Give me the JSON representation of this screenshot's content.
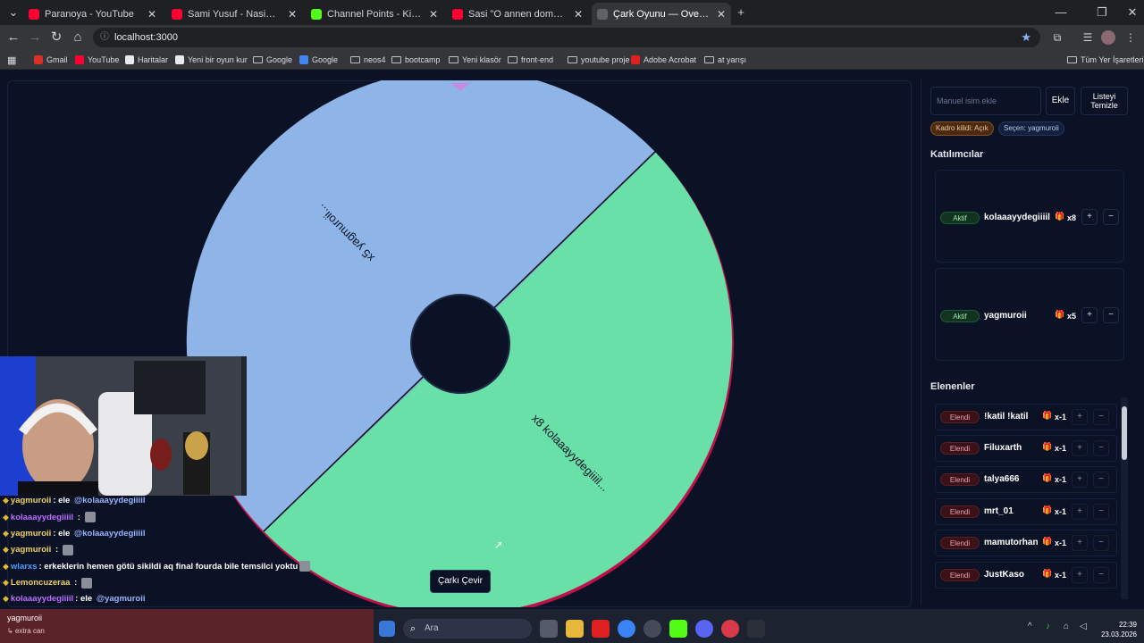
{
  "browser": {
    "tabs": [
      {
        "title": "Paranoya - YouTube",
        "color": "#ff0033",
        "active": false
      },
      {
        "title": "Sami Yusuf - Nasimi #worldmu",
        "color": "#ff0033",
        "active": false
      },
      {
        "title": "Channel Points - Kick Dashboar",
        "color": "#53fc18",
        "active": false
      },
      {
        "title": "Sasi \"O annen domaltılacak\" dı",
        "color": "#ff0033",
        "active": false
      },
      {
        "title": "Çark Oyunu — Overlay",
        "color": "#5f6368",
        "active": true
      }
    ],
    "url": "localhost:3000",
    "bookmarks": [
      "Gmail",
      "YouTube",
      "Haritalar",
      "Yeni bir oyun kur",
      "Google",
      "Google",
      "neos4",
      "bootcamp",
      "Yeni klasör",
      "front-end",
      "youtube proje",
      "Adobe Acrobat",
      "at yarışı"
    ],
    "all_bookmarks": "Tüm Yer İşaretleri"
  },
  "wheel": {
    "segments": [
      {
        "label": "x5 yagmuroii...",
        "color": "#8fb5e8"
      },
      {
        "label": "x8 kolaaayydegiiiil...",
        "color": "#69e0a8"
      }
    ],
    "rim_color": "#c0104a",
    "hub_color": "#0b1226",
    "pointer_color": "#c58be0",
    "spin_label": "Çarkı Çevir"
  },
  "controls": {
    "name_placeholder": "Manuel isim ekle",
    "add_label": "Ekle",
    "clear_label": "Listeyi Temizle",
    "lock_pill": "Kadro kilidi: Açık",
    "selector_pill": "Seçen: yagmuroii"
  },
  "participants": {
    "heading": "Katılımcılar",
    "items": [
      {
        "status": "Aktif",
        "name": "kolaaayydegiiiil",
        "mult": "x8"
      },
      {
        "status": "Aktif",
        "name": "yagmuroii",
        "mult": "x5"
      }
    ]
  },
  "eliminated": {
    "heading": "Elenenler",
    "items": [
      {
        "status": "Elendi",
        "name": "!katil !katil",
        "mult": "x-1"
      },
      {
        "status": "Elendi",
        "name": "Filuxarth",
        "mult": "x-1"
      },
      {
        "status": "Elendi",
        "name": "talya666",
        "mult": "x-1"
      },
      {
        "status": "Elendi",
        "name": "mrt_01",
        "mult": "x-1"
      },
      {
        "status": "Elendi",
        "name": "mamutorhan",
        "mult": "x-1"
      },
      {
        "status": "Elendi",
        "name": "JustKaso",
        "mult": "x-1"
      }
    ]
  },
  "chat": [
    {
      "user": "yagmuroii",
      "color": "#f0d060",
      "text": ": ele ",
      "mention": "@kolaaayydegiiiil"
    },
    {
      "user": "kolaaayydegiiiil",
      "color": "#c06cff",
      "text": " : ",
      "mention": ""
    },
    {
      "user": "yagmuroii",
      "color": "#f0d060",
      "text": ": ele ",
      "mention": "@kolaaayydegiiiil"
    },
    {
      "user": "yagmuroii",
      "color": "#f0d060",
      "text": " : ",
      "mention": ""
    },
    {
      "user": "wlarxs",
      "color": "#4a9cff",
      "text": ": erkeklerin hemen götü sikildi aq final fourda bile temsilci yoktu",
      "mention": ""
    },
    {
      "user": "Lemoncuzeraa",
      "color": "#f0d060",
      "text": " : ",
      "mention": ""
    },
    {
      "user": "kolaaayydegiiiil",
      "color": "#c06cff",
      "text": ": ele ",
      "mention": "@yagmuroii"
    }
  ],
  "alert": {
    "user": "yagmuroii",
    "reward": "extra can"
  },
  "taskbar": {
    "search": "Ara",
    "time": "22:39",
    "date": "23.03.2026"
  }
}
